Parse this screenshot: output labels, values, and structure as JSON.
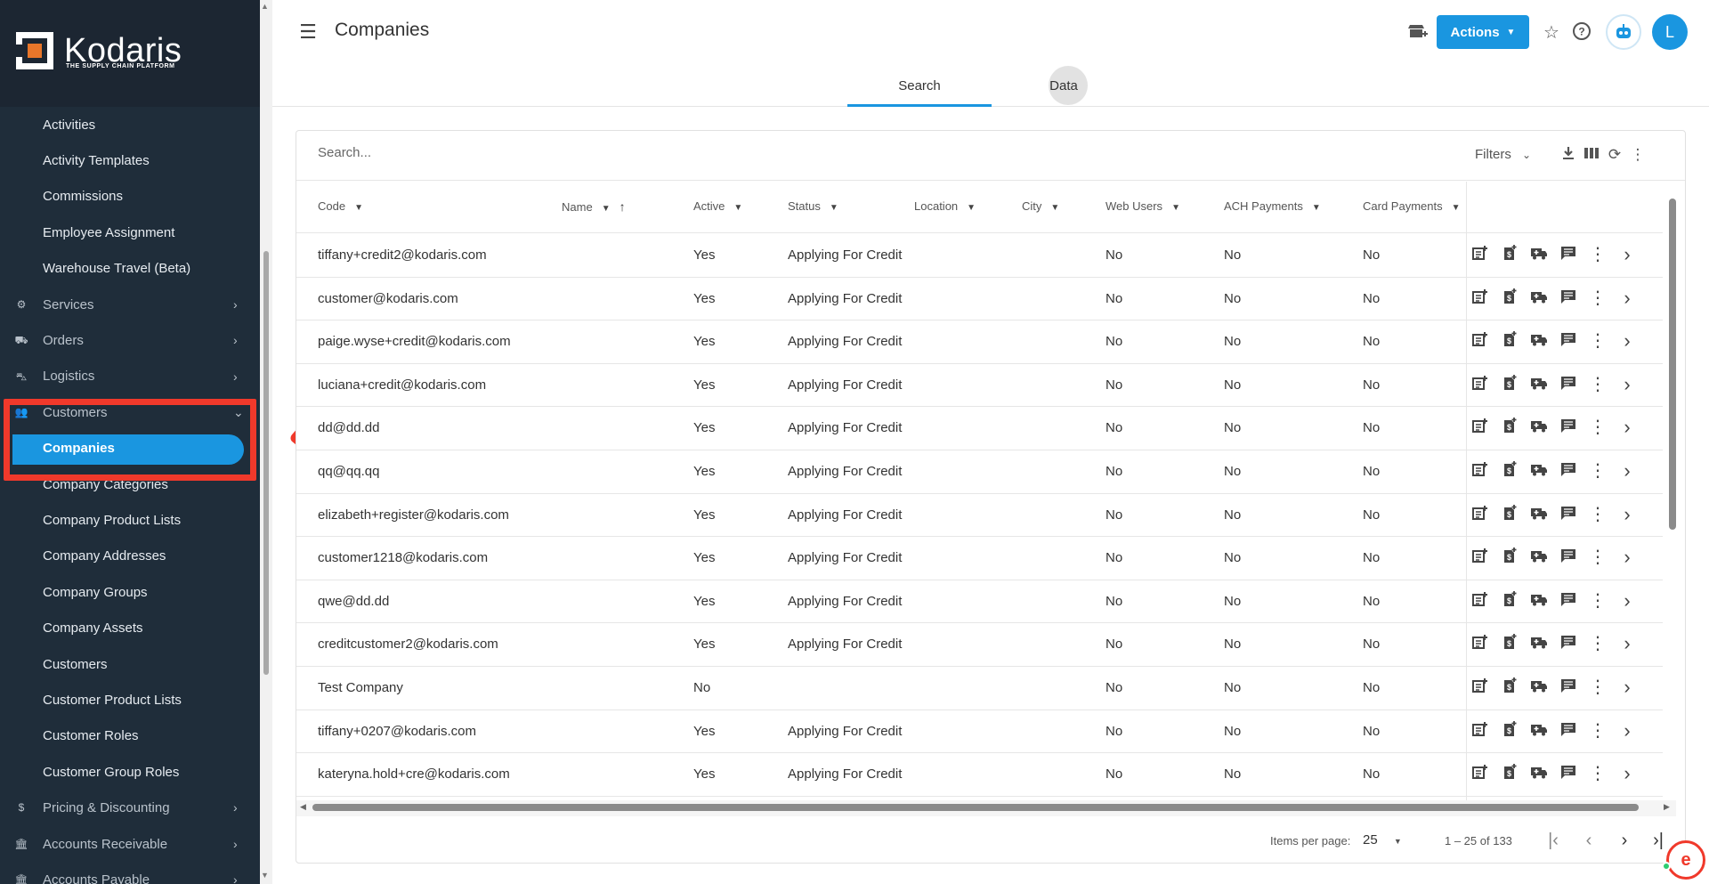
{
  "brand": {
    "name": "Kodaris",
    "tagline": "THE SUPPLY CHAIN PLATFORM"
  },
  "sidebar": {
    "items": [
      {
        "label": "Activities",
        "type": "sub"
      },
      {
        "label": "Activity Templates",
        "type": "sub"
      },
      {
        "label": "Commissions",
        "type": "sub"
      },
      {
        "label": "Employee Assignment",
        "type": "sub"
      },
      {
        "label": "Warehouse Travel (Beta)",
        "type": "sub"
      },
      {
        "label": "Services",
        "type": "group",
        "icon": "gears-icon"
      },
      {
        "label": "Orders",
        "type": "group",
        "icon": "truck-icon"
      },
      {
        "label": "Logistics",
        "type": "group",
        "icon": "car-icon"
      },
      {
        "label": "Customers",
        "type": "group-open",
        "icon": "users-icon"
      },
      {
        "label": "Companies",
        "type": "active"
      },
      {
        "label": "Company Categories",
        "type": "sub"
      },
      {
        "label": "Company Product Lists",
        "type": "sub"
      },
      {
        "label": "Company Addresses",
        "type": "sub"
      },
      {
        "label": "Company Groups",
        "type": "sub"
      },
      {
        "label": "Company Assets",
        "type": "sub"
      },
      {
        "label": "Customers",
        "type": "sub"
      },
      {
        "label": "Customer Product Lists",
        "type": "sub"
      },
      {
        "label": "Customer Roles",
        "type": "sub"
      },
      {
        "label": "Customer Group Roles",
        "type": "sub"
      },
      {
        "label": "Pricing & Discounting",
        "type": "group",
        "icon": "dollar-icon"
      },
      {
        "label": "Accounts Receivable",
        "type": "group",
        "icon": "bank-icon"
      },
      {
        "label": "Accounts Payable",
        "type": "group",
        "icon": "bank-icon"
      }
    ]
  },
  "header": {
    "title": "Companies",
    "actions_label": "Actions",
    "avatar_initial": "L",
    "tabs": [
      "Search",
      "Data"
    ]
  },
  "grid": {
    "search_placeholder": "Search...",
    "filters_label": "Filters",
    "columns": [
      "Code",
      "Name",
      "Active",
      "Status",
      "Location",
      "City",
      "Web Users",
      "ACH Payments",
      "Card Payments"
    ],
    "rows": [
      {
        "code": "tiffany+credit2@kodaris.com",
        "name": "",
        "active": "Yes",
        "status": "Applying For Credit",
        "location": "",
        "city": "",
        "web_users": "No",
        "ach": "No",
        "card": "No"
      },
      {
        "code": "customer@kodaris.com",
        "name": "",
        "active": "Yes",
        "status": "Applying For Credit",
        "location": "",
        "city": "",
        "web_users": "No",
        "ach": "No",
        "card": "No"
      },
      {
        "code": "paige.wyse+credit@kodaris.com",
        "name": "",
        "active": "Yes",
        "status": "Applying For Credit",
        "location": "",
        "city": "",
        "web_users": "No",
        "ach": "No",
        "card": "No"
      },
      {
        "code": "luciana+credit@kodaris.com",
        "name": "",
        "active": "Yes",
        "status": "Applying For Credit",
        "location": "",
        "city": "",
        "web_users": "No",
        "ach": "No",
        "card": "No"
      },
      {
        "code": "dd@dd.dd",
        "name": "",
        "active": "Yes",
        "status": "Applying For Credit",
        "location": "",
        "city": "",
        "web_users": "No",
        "ach": "No",
        "card": "No"
      },
      {
        "code": "qq@qq.qq",
        "name": "",
        "active": "Yes",
        "status": "Applying For Credit",
        "location": "",
        "city": "",
        "web_users": "No",
        "ach": "No",
        "card": "No"
      },
      {
        "code": "elizabeth+register@kodaris.com",
        "name": "",
        "active": "Yes",
        "status": "Applying For Credit",
        "location": "",
        "city": "",
        "web_users": "No",
        "ach": "No",
        "card": "No"
      },
      {
        "code": "customer1218@kodaris.com",
        "name": "",
        "active": "Yes",
        "status": "Applying For Credit",
        "location": "",
        "city": "",
        "web_users": "No",
        "ach": "No",
        "card": "No"
      },
      {
        "code": "qwe@dd.dd",
        "name": "",
        "active": "Yes",
        "status": "Applying For Credit",
        "location": "",
        "city": "",
        "web_users": "No",
        "ach": "No",
        "card": "No"
      },
      {
        "code": "creditcustomer2@kodaris.com",
        "name": "",
        "active": "Yes",
        "status": "Applying For Credit",
        "location": "",
        "city": "",
        "web_users": "No",
        "ach": "No",
        "card": "No"
      },
      {
        "code": "Test Company",
        "name": "",
        "active": "No",
        "status": "",
        "location": "",
        "city": "",
        "web_users": "No",
        "ach": "No",
        "card": "No"
      },
      {
        "code": "tiffany+0207@kodaris.com",
        "name": "",
        "active": "Yes",
        "status": "Applying For Credit",
        "location": "",
        "city": "",
        "web_users": "No",
        "ach": "No",
        "card": "No"
      },
      {
        "code": "kateryna.hold+cre@kodaris.com",
        "name": "",
        "active": "Yes",
        "status": "Applying For Credit",
        "location": "",
        "city": "",
        "web_users": "No",
        "ach": "No",
        "card": "No"
      }
    ],
    "row_action_icons": [
      "add-note-icon",
      "payment-doc-icon",
      "ambulance-icon",
      "comment-icon",
      "more-vert-icon",
      "chevron-right-icon"
    ]
  },
  "paginator": {
    "items_per_page_label": "Items per page:",
    "items_per_page": "25",
    "range": "1 – 25 of 133"
  },
  "colors": {
    "accent": "#1a96e0",
    "sidebar_bg": "#1f2d3a",
    "annotation_red": "#f0392b"
  }
}
